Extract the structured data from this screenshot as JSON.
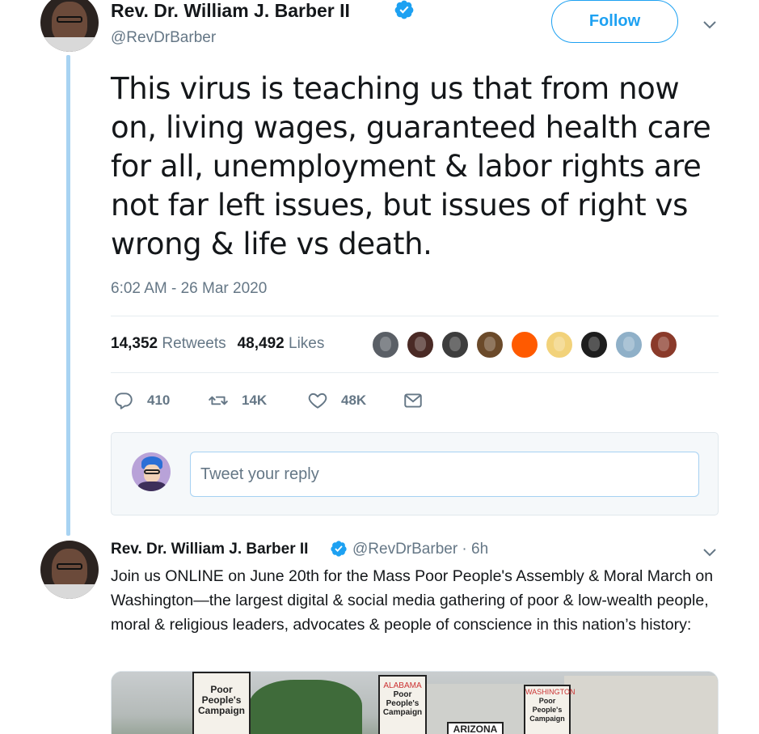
{
  "tweet": {
    "author_name": "Rev. Dr. William J. Barber II",
    "author_handle": "@RevDrBarber",
    "follow_label": "Follow",
    "text": "This virus is teaching us that from now on, living wages, guaranteed health care for all, unemployment & labor rights are not far left issues, but issues of right vs wrong & life vs death.",
    "timestamp": "6:02 AM - 26 Mar 2020",
    "retweets_count": "14,352",
    "retweets_label": "Retweets",
    "likes_count": "48,492",
    "likes_label": "Likes",
    "liker_colors": [
      "#5a5f66",
      "#4a2a25",
      "#3d3d3d",
      "#6b4a2a",
      "#ff5a00",
      "#f2d27a",
      "#1e1e1e",
      "#8fb0c8",
      "#8a3a2a"
    ]
  },
  "actions": {
    "reply_count": "410",
    "retweet_count": "14K",
    "like_count": "48K",
    "icons": [
      "reply-icon",
      "retweet-icon",
      "heart-icon",
      "message-icon"
    ]
  },
  "reply_box": {
    "placeholder": "Tweet your reply"
  },
  "tweet2": {
    "author_name": "Rev. Dr. William J. Barber II",
    "handle_time": "@RevDrBarber · 6h",
    "text": "Join us ONLINE on June 20th for the Mass Poor People's Assembly & Moral March on Washington—the largest digital & social media gathering of poor & low-wealth people, moral & religious leaders, advocates & people of conscience in this nation’s history:"
  },
  "media": {
    "signs": [
      "Poor People's Campaign",
      "ALABAMA",
      "ARIZONA",
      "WASHINGTON"
    ]
  },
  "colors": {
    "accent": "#1da1f2",
    "thread_line": "#a8d3f2",
    "muted": "#657786"
  }
}
